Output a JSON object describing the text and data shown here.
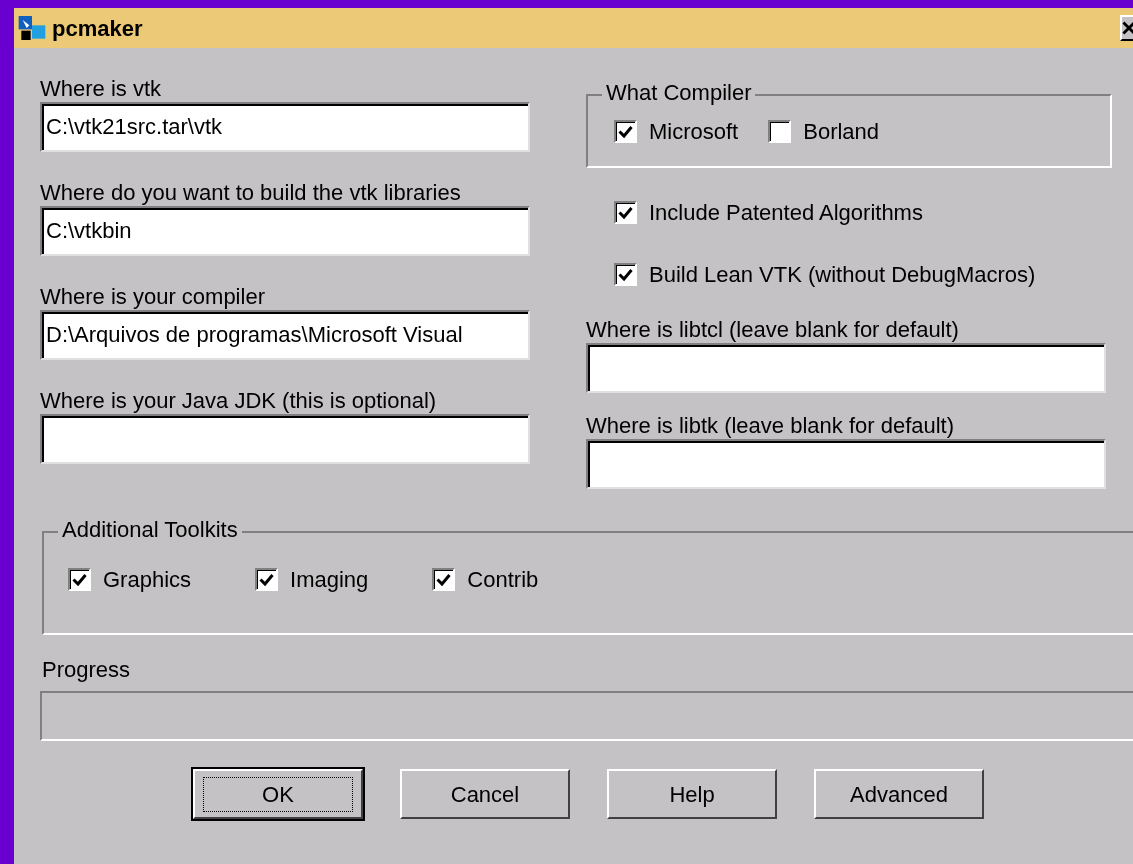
{
  "window": {
    "title": "pcmaker"
  },
  "left_fields": [
    {
      "label": "Where is vtk",
      "value": "C:\\vtk21src.tar\\vtk"
    },
    {
      "label": "Where do you want to build the vtk libraries",
      "value": "C:\\vtkbin"
    },
    {
      "label": "Where is your compiler",
      "value": "D:\\Arquivos de programas\\Microsoft Visual"
    },
    {
      "label": "Where is your Java JDK (this is optional)"
    }
  ],
  "compiler_group": {
    "title": "What Compiler",
    "options": [
      {
        "label": "Microsoft",
        "checked": true
      },
      {
        "label": "Borland",
        "checked": false
      }
    ]
  },
  "options": [
    {
      "label": "Include Patented Algorithms",
      "checked": true
    },
    {
      "label": "Build Lean VTK (without DebugMacros)",
      "checked": true
    }
  ],
  "right_fields": [
    {
      "label": "Where is libtcl (leave blank for default)"
    },
    {
      "label": "Where is libtk (leave blank for default)"
    }
  ],
  "toolkits_group": {
    "title": "Additional Toolkits",
    "options": [
      {
        "label": "Graphics",
        "checked": true
      },
      {
        "label": "Imaging",
        "checked": true
      },
      {
        "label": "Contrib",
        "checked": true
      }
    ]
  },
  "progress": {
    "label": "Progress"
  },
  "buttons": [
    {
      "label": "OK",
      "default": true
    },
    {
      "label": "Cancel",
      "default": false
    },
    {
      "label": "Help",
      "default": false
    },
    {
      "label": "Advanced",
      "default": false
    }
  ]
}
